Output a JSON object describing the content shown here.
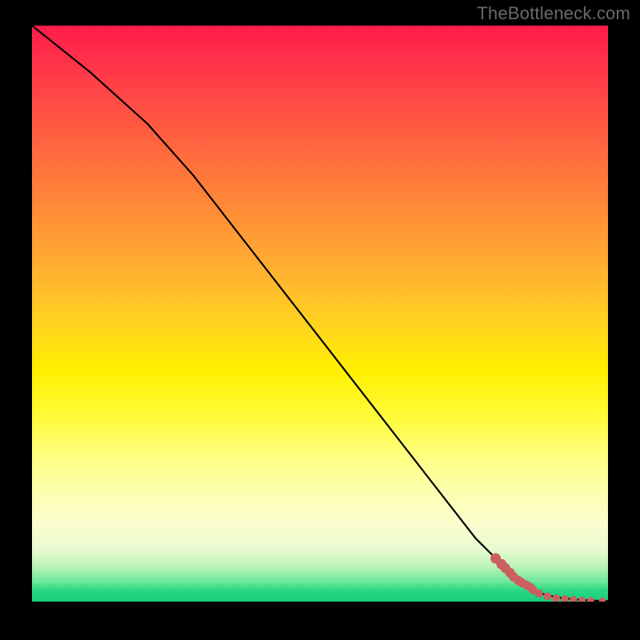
{
  "watermark": "TheBottleneck.com",
  "colors": {
    "page_bg": "#000000",
    "curve": "#000000",
    "marker": "#cc5f60",
    "gradient_top": "#ff1c4b",
    "gradient_bottom": "#18cf7c"
  },
  "chart_data": {
    "type": "line",
    "title": "",
    "xlabel": "",
    "ylabel": "",
    "xlim": [
      0,
      100
    ],
    "ylim": [
      0,
      100
    ],
    "x": [
      0,
      10,
      20,
      28,
      35,
      42,
      49,
      56,
      63,
      70,
      77,
      80,
      82,
      84,
      85,
      87,
      88,
      90,
      91,
      92,
      93,
      95,
      97,
      98,
      100
    ],
    "y": [
      100,
      92,
      83,
      74,
      65,
      56,
      47,
      38,
      29,
      20,
      11,
      8,
      6,
      4,
      3,
      2,
      1.5,
      1,
      0.8,
      0.6,
      0.5,
      0.3,
      0.2,
      0.15,
      0.1
    ],
    "markers": {
      "x": [
        80.5,
        81.5,
        82.2,
        83.0,
        83.6,
        84.4,
        85.0,
        85.8,
        86.5,
        87.0,
        88.0,
        89.5,
        91.0,
        92.5,
        94.0,
        95.5,
        97.0,
        99.0
      ],
      "y": [
        7.5,
        6.5,
        5.8,
        5.0,
        4.3,
        3.7,
        3.3,
        2.9,
        2.5,
        2.0,
        1.4,
        0.9,
        0.6,
        0.45,
        0.35,
        0.25,
        0.2,
        0.15
      ]
    }
  }
}
